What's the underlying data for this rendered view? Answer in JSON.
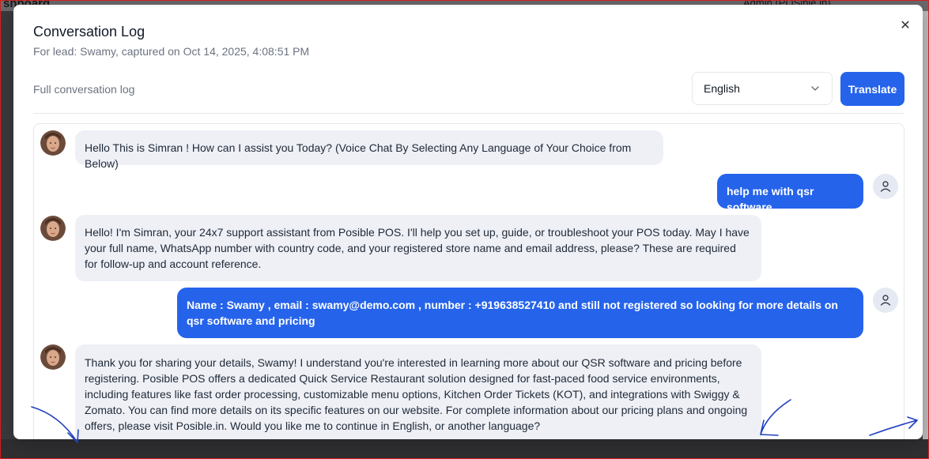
{
  "background": {
    "title": "shboard",
    "user": "Admin (POSible.in)"
  },
  "modal": {
    "title": "Conversation Log",
    "subtitle": "For lead: Swamy, captured on Oct 14, 2025, 4:08:51 PM",
    "log_label": "Full conversation log",
    "language_select": {
      "selected": "English"
    },
    "translate_label": "Translate",
    "close_label": "✕"
  },
  "messages": [
    {
      "role": "bot",
      "text": "Hello This is Simran ! How can I assist you Today? (Voice Chat By Selecting Any Language of Your Choice from Below)"
    },
    {
      "role": "user",
      "text": "help me with qsr software"
    },
    {
      "role": "bot",
      "text": "Hello! I'm Simran, your 24x7 support assistant from Posible POS. I'll help you set up, guide, or troubleshoot your POS today. May I have your full name, WhatsApp number with country code, and your registered store name and email address, please? These are required for follow-up and account reference."
    },
    {
      "role": "user",
      "text": "Name : Swamy , email : swamy@demo.com , number : +919638527410 and still not registered so looking for more details on qsr software and pricing"
    },
    {
      "role": "bot",
      "text": "Thank you for sharing your details, Swamy! I understand you're interested in learning more about our QSR software and pricing before registering. Posible POS offers a dedicated Quick Service Restaurant solution designed for fast-paced food service environments, including features like fast order processing, customizable menu options, Kitchen Order Tickets (KOT), and integrations with Swiggy & Zomato. You can find more details on its specific features on our website. For complete information about our pricing plans and ongoing offers, please visit Posible.in. Would you like me to continue in English, or another language?"
    }
  ],
  "colors": {
    "accent": "#2563eb",
    "bot_bubble": "#eef0f6",
    "annotation": "#1f3fbf"
  }
}
